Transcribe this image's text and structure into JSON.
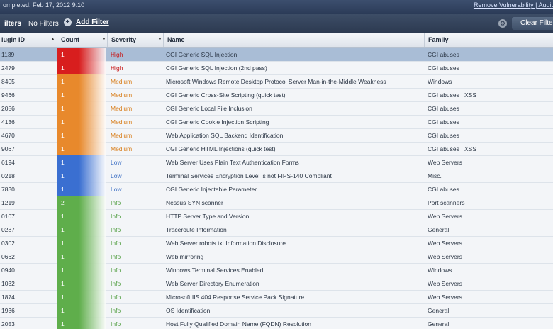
{
  "top": {
    "completed": "ompleted: Feb 17, 2012 9:10",
    "links": "Remove Vulnerability | Audit"
  },
  "filterbar": {
    "label": "ilters",
    "no_filters": "No Filters",
    "add_filter": "Add Filter",
    "clear_filters": "Clear Filters"
  },
  "columns": {
    "plugin_id": "lugin ID",
    "count": "Count",
    "severity": "Severity",
    "name": "Name",
    "family": "Family"
  },
  "severity_colors": {
    "High": "#d81e1e",
    "Medium": "#e8892c",
    "Low": "#3a6fd1",
    "Info": "#5fae4b"
  },
  "rows": [
    {
      "plugin_id": "1139",
      "count": "1",
      "severity": "High",
      "name": "CGI Generic SQL Injection",
      "family": "CGI abuses"
    },
    {
      "plugin_id": "2479",
      "count": "1",
      "severity": "High",
      "name": "CGI Generic SQL Injection (2nd pass)",
      "family": "CGI abuses"
    },
    {
      "plugin_id": "8405",
      "count": "1",
      "severity": "Medium",
      "name": "Microsoft Windows Remote Desktop Protocol Server Man-in-the-Middle Weakness",
      "family": "Windows"
    },
    {
      "plugin_id": "9466",
      "count": "1",
      "severity": "Medium",
      "name": "CGI Generic Cross-Site Scripting (quick test)",
      "family": "CGI abuses : XSS"
    },
    {
      "plugin_id": "2056",
      "count": "1",
      "severity": "Medium",
      "name": "CGI Generic Local File Inclusion",
      "family": "CGI abuses"
    },
    {
      "plugin_id": "4136",
      "count": "1",
      "severity": "Medium",
      "name": "CGI Generic Cookie Injection Scripting",
      "family": "CGI abuses"
    },
    {
      "plugin_id": "4670",
      "count": "1",
      "severity": "Medium",
      "name": "Web Application SQL Backend Identification",
      "family": "CGI abuses"
    },
    {
      "plugin_id": "9067",
      "count": "1",
      "severity": "Medium",
      "name": "CGI Generic HTML Injections (quick test)",
      "family": "CGI abuses : XSS"
    },
    {
      "plugin_id": "6194",
      "count": "1",
      "severity": "Low",
      "name": "Web Server Uses Plain Text Authentication Forms",
      "family": "Web Servers"
    },
    {
      "plugin_id": "0218",
      "count": "1",
      "severity": "Low",
      "name": "Terminal Services Encryption Level is not FIPS-140 Compliant",
      "family": "Misc."
    },
    {
      "plugin_id": "7830",
      "count": "1",
      "severity": "Low",
      "name": "CGI Generic Injectable Parameter",
      "family": "CGI abuses"
    },
    {
      "plugin_id": "1219",
      "count": "2",
      "severity": "Info",
      "name": "Nessus SYN scanner",
      "family": "Port scanners"
    },
    {
      "plugin_id": "0107",
      "count": "1",
      "severity": "Info",
      "name": "HTTP Server Type and Version",
      "family": "Web Servers"
    },
    {
      "plugin_id": "0287",
      "count": "1",
      "severity": "Info",
      "name": "Traceroute Information",
      "family": "General"
    },
    {
      "plugin_id": "0302",
      "count": "1",
      "severity": "Info",
      "name": "Web Server robots.txt Information Disclosure",
      "family": "Web Servers"
    },
    {
      "plugin_id": "0662",
      "count": "1",
      "severity": "Info",
      "name": "Web mirroring",
      "family": "Web Servers"
    },
    {
      "plugin_id": "0940",
      "count": "1",
      "severity": "Info",
      "name": "Windows Terminal Services Enabled",
      "family": "Windows"
    },
    {
      "plugin_id": "1032",
      "count": "1",
      "severity": "Info",
      "name": "Web Server Directory Enumeration",
      "family": "Web Servers"
    },
    {
      "plugin_id": "1874",
      "count": "1",
      "severity": "Info",
      "name": "Microsoft IIS 404 Response Service Pack Signature",
      "family": "Web Servers"
    },
    {
      "plugin_id": "1936",
      "count": "1",
      "severity": "Info",
      "name": "OS Identification",
      "family": "General"
    },
    {
      "plugin_id": "2053",
      "count": "1",
      "severity": "Info",
      "name": "Host Fully Qualified Domain Name (FQDN) Resolution",
      "family": "General"
    }
  ]
}
